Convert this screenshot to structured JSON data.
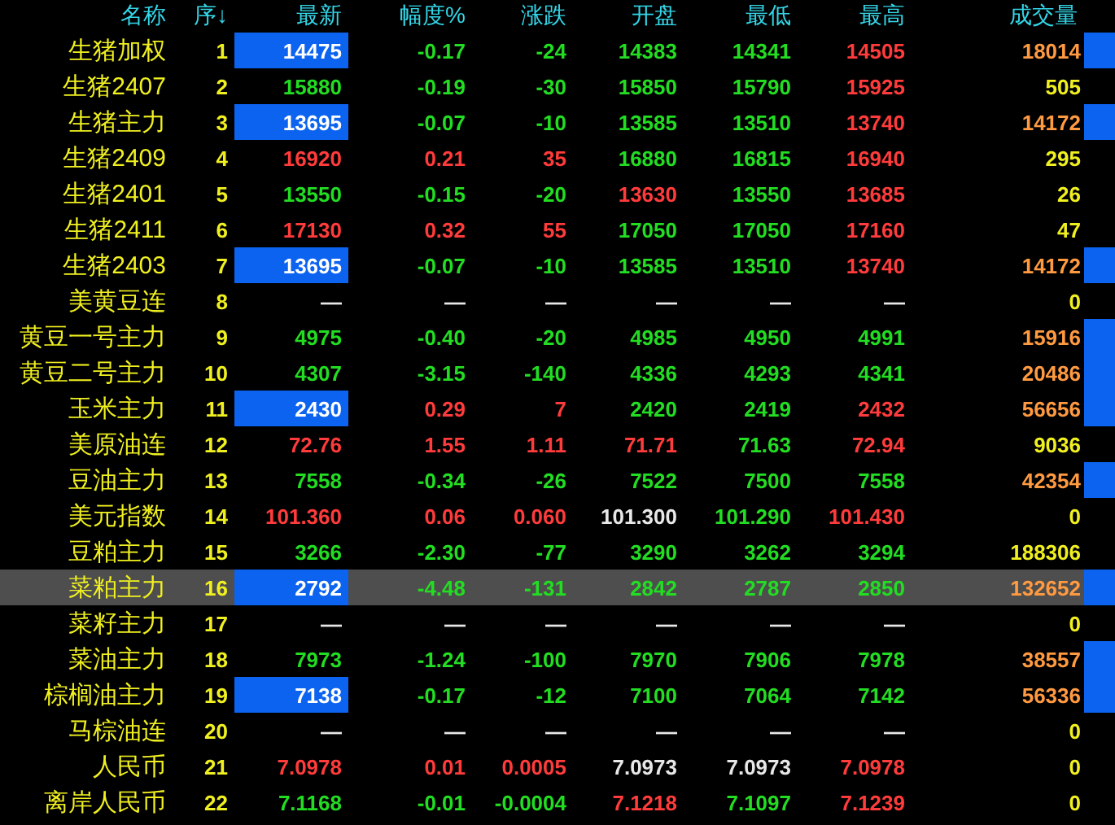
{
  "columns": [
    "名称",
    "序↓",
    "最新",
    "幅度%",
    "涨跌",
    "开盘",
    "最低",
    "最高",
    "成交量"
  ],
  "rows": [
    {
      "name": "生猪加权",
      "index": "1",
      "selected": false,
      "latest": {
        "text": "14475",
        "flash": true
      },
      "cells": [
        {
          "text": "-0.17",
          "color": "#22dd22"
        },
        {
          "text": "-24",
          "color": "#22dd22"
        },
        {
          "text": "14383",
          "color": "#22dd22"
        },
        {
          "text": "14341",
          "color": "#22dd22"
        },
        {
          "text": "14505",
          "color": "#ff3b3b"
        }
      ],
      "volume": "18014",
      "volume_alert": true
    },
    {
      "name": "生猪2407",
      "index": "2",
      "selected": false,
      "latest": {
        "text": "15880",
        "color": "#22dd22",
        "flash": false
      },
      "cells": [
        {
          "text": "-0.19",
          "color": "#22dd22"
        },
        {
          "text": "-30",
          "color": "#22dd22"
        },
        {
          "text": "15850",
          "color": "#22dd22"
        },
        {
          "text": "15790",
          "color": "#22dd22"
        },
        {
          "text": "15925",
          "color": "#ff3b3b"
        }
      ],
      "volume": "505",
      "volume_alert": false
    },
    {
      "name": "生猪主力",
      "index": "3",
      "selected": false,
      "latest": {
        "text": "13695",
        "flash": true
      },
      "cells": [
        {
          "text": "-0.07",
          "color": "#22dd22"
        },
        {
          "text": "-10",
          "color": "#22dd22"
        },
        {
          "text": "13585",
          "color": "#22dd22"
        },
        {
          "text": "13510",
          "color": "#22dd22"
        },
        {
          "text": "13740",
          "color": "#ff3b3b"
        }
      ],
      "volume": "14172",
      "volume_alert": true
    },
    {
      "name": "生猪2409",
      "index": "4",
      "selected": false,
      "latest": {
        "text": "16920",
        "color": "#ff3b3b",
        "flash": false
      },
      "cells": [
        {
          "text": "0.21",
          "color": "#ff3b3b"
        },
        {
          "text": "35",
          "color": "#ff3b3b"
        },
        {
          "text": "16880",
          "color": "#22dd22"
        },
        {
          "text": "16815",
          "color": "#22dd22"
        },
        {
          "text": "16940",
          "color": "#ff3b3b"
        }
      ],
      "volume": "295",
      "volume_alert": false
    },
    {
      "name": "生猪2401",
      "index": "5",
      "selected": false,
      "latest": {
        "text": "13550",
        "color": "#22dd22",
        "flash": false
      },
      "cells": [
        {
          "text": "-0.15",
          "color": "#22dd22"
        },
        {
          "text": "-20",
          "color": "#22dd22"
        },
        {
          "text": "13630",
          "color": "#ff3b3b"
        },
        {
          "text": "13550",
          "color": "#22dd22"
        },
        {
          "text": "13685",
          "color": "#ff3b3b"
        }
      ],
      "volume": "26",
      "volume_alert": false
    },
    {
      "name": "生猪2411",
      "index": "6",
      "selected": false,
      "latest": {
        "text": "17130",
        "color": "#ff3b3b",
        "flash": false
      },
      "cells": [
        {
          "text": "0.32",
          "color": "#ff3b3b"
        },
        {
          "text": "55",
          "color": "#ff3b3b"
        },
        {
          "text": "17050",
          "color": "#22dd22"
        },
        {
          "text": "17050",
          "color": "#22dd22"
        },
        {
          "text": "17160",
          "color": "#ff3b3b"
        }
      ],
      "volume": "47",
      "volume_alert": false
    },
    {
      "name": "生猪2403",
      "index": "7",
      "selected": false,
      "latest": {
        "text": "13695",
        "flash": true
      },
      "cells": [
        {
          "text": "-0.07",
          "color": "#22dd22"
        },
        {
          "text": "-10",
          "color": "#22dd22"
        },
        {
          "text": "13585",
          "color": "#22dd22"
        },
        {
          "text": "13510",
          "color": "#22dd22"
        },
        {
          "text": "13740",
          "color": "#ff3b3b"
        }
      ],
      "volume": "14172",
      "volume_alert": true
    },
    {
      "name": "美黄豆连",
      "index": "8",
      "selected": false,
      "latest": {
        "text": "—",
        "color": "#e8e8e8",
        "flash": false
      },
      "cells": [
        {
          "text": "—",
          "color": "#e8e8e8"
        },
        {
          "text": "—",
          "color": "#e8e8e8"
        },
        {
          "text": "—",
          "color": "#e8e8e8"
        },
        {
          "text": "—",
          "color": "#e8e8e8"
        },
        {
          "text": "—",
          "color": "#e8e8e8"
        }
      ],
      "volume": "0",
      "volume_alert": false
    },
    {
      "name": "黄豆一号主力",
      "index": "9",
      "selected": false,
      "latest": {
        "text": "4975",
        "color": "#22dd22",
        "flash": false
      },
      "cells": [
        {
          "text": "-0.40",
          "color": "#22dd22"
        },
        {
          "text": "-20",
          "color": "#22dd22"
        },
        {
          "text": "4985",
          "color": "#22dd22"
        },
        {
          "text": "4950",
          "color": "#22dd22"
        },
        {
          "text": "4991",
          "color": "#22dd22"
        }
      ],
      "volume": "15916",
      "volume_alert": true
    },
    {
      "name": "黄豆二号主力",
      "index": "10",
      "selected": false,
      "latest": {
        "text": "4307",
        "color": "#22dd22",
        "flash": false
      },
      "cells": [
        {
          "text": "-3.15",
          "color": "#22dd22"
        },
        {
          "text": "-140",
          "color": "#22dd22"
        },
        {
          "text": "4336",
          "color": "#22dd22"
        },
        {
          "text": "4293",
          "color": "#22dd22"
        },
        {
          "text": "4341",
          "color": "#22dd22"
        }
      ],
      "volume": "20486",
      "volume_alert": true
    },
    {
      "name": "玉米主力",
      "index": "11",
      "selected": false,
      "latest": {
        "text": "2430",
        "flash": true
      },
      "cells": [
        {
          "text": "0.29",
          "color": "#ff3b3b"
        },
        {
          "text": "7",
          "color": "#ff3b3b"
        },
        {
          "text": "2420",
          "color": "#22dd22"
        },
        {
          "text": "2419",
          "color": "#22dd22"
        },
        {
          "text": "2432",
          "color": "#ff3b3b"
        }
      ],
      "volume": "56656",
      "volume_alert": true
    },
    {
      "name": "美原油连",
      "index": "12",
      "selected": false,
      "latest": {
        "text": "72.76",
        "color": "#ff3b3b",
        "flash": false
      },
      "cells": [
        {
          "text": "1.55",
          "color": "#ff3b3b"
        },
        {
          "text": "1.11",
          "color": "#ff3b3b"
        },
        {
          "text": "71.71",
          "color": "#ff3b3b"
        },
        {
          "text": "71.63",
          "color": "#22dd22"
        },
        {
          "text": "72.94",
          "color": "#ff3b3b"
        }
      ],
      "volume": "9036",
      "volume_alert": false
    },
    {
      "name": "豆油主力",
      "index": "13",
      "selected": false,
      "latest": {
        "text": "7558",
        "color": "#22dd22",
        "flash": false
      },
      "cells": [
        {
          "text": "-0.34",
          "color": "#22dd22"
        },
        {
          "text": "-26",
          "color": "#22dd22"
        },
        {
          "text": "7522",
          "color": "#22dd22"
        },
        {
          "text": "7500",
          "color": "#22dd22"
        },
        {
          "text": "7558",
          "color": "#22dd22"
        }
      ],
      "volume": "42354",
      "volume_alert": true
    },
    {
      "name": "美元指数",
      "index": "14",
      "selected": false,
      "latest": {
        "text": "101.360",
        "color": "#ff3b3b",
        "flash": false
      },
      "cells": [
        {
          "text": "0.06",
          "color": "#ff3b3b"
        },
        {
          "text": "0.060",
          "color": "#ff3b3b"
        },
        {
          "text": "101.300",
          "color": "#e8e8e8"
        },
        {
          "text": "101.290",
          "color": "#22dd22"
        },
        {
          "text": "101.430",
          "color": "#ff3b3b"
        }
      ],
      "volume": "0",
      "volume_alert": false
    },
    {
      "name": "豆粕主力",
      "index": "15",
      "selected": false,
      "latest": {
        "text": "3266",
        "color": "#22dd22",
        "flash": false
      },
      "cells": [
        {
          "text": "-2.30",
          "color": "#22dd22"
        },
        {
          "text": "-77",
          "color": "#22dd22"
        },
        {
          "text": "3290",
          "color": "#22dd22"
        },
        {
          "text": "3262",
          "color": "#22dd22"
        },
        {
          "text": "3294",
          "color": "#22dd22"
        }
      ],
      "volume": "188306",
      "volume_alert": false
    },
    {
      "name": "菜粕主力",
      "index": "16",
      "selected": true,
      "latest": {
        "text": "2792",
        "flash": true
      },
      "cells": [
        {
          "text": "-4.48",
          "color": "#22dd22"
        },
        {
          "text": "-131",
          "color": "#22dd22"
        },
        {
          "text": "2842",
          "color": "#22dd22"
        },
        {
          "text": "2787",
          "color": "#22dd22"
        },
        {
          "text": "2850",
          "color": "#22dd22"
        }
      ],
      "volume": "132652",
      "volume_alert": true
    },
    {
      "name": "菜籽主力",
      "index": "17",
      "selected": false,
      "latest": {
        "text": "—",
        "color": "#e8e8e8",
        "flash": false
      },
      "cells": [
        {
          "text": "—",
          "color": "#e8e8e8"
        },
        {
          "text": "—",
          "color": "#e8e8e8"
        },
        {
          "text": "—",
          "color": "#e8e8e8"
        },
        {
          "text": "—",
          "color": "#e8e8e8"
        },
        {
          "text": "—",
          "color": "#e8e8e8"
        }
      ],
      "volume": "0",
      "volume_alert": false
    },
    {
      "name": "菜油主力",
      "index": "18",
      "selected": false,
      "latest": {
        "text": "7973",
        "color": "#22dd22",
        "flash": false
      },
      "cells": [
        {
          "text": "-1.24",
          "color": "#22dd22"
        },
        {
          "text": "-100",
          "color": "#22dd22"
        },
        {
          "text": "7970",
          "color": "#22dd22"
        },
        {
          "text": "7906",
          "color": "#22dd22"
        },
        {
          "text": "7978",
          "color": "#22dd22"
        }
      ],
      "volume": "38557",
      "volume_alert": true
    },
    {
      "name": "棕榈油主力",
      "index": "19",
      "selected": false,
      "latest": {
        "text": "7138",
        "flash": true
      },
      "cells": [
        {
          "text": "-0.17",
          "color": "#22dd22"
        },
        {
          "text": "-12",
          "color": "#22dd22"
        },
        {
          "text": "7100",
          "color": "#22dd22"
        },
        {
          "text": "7064",
          "color": "#22dd22"
        },
        {
          "text": "7142",
          "color": "#22dd22"
        }
      ],
      "volume": "56336",
      "volume_alert": true
    },
    {
      "name": "马棕油连",
      "index": "20",
      "selected": false,
      "latest": {
        "text": "—",
        "color": "#e8e8e8",
        "flash": false
      },
      "cells": [
        {
          "text": "—",
          "color": "#e8e8e8"
        },
        {
          "text": "—",
          "color": "#e8e8e8"
        },
        {
          "text": "—",
          "color": "#e8e8e8"
        },
        {
          "text": "—",
          "color": "#e8e8e8"
        },
        {
          "text": "—",
          "color": "#e8e8e8"
        }
      ],
      "volume": "0",
      "volume_alert": false
    },
    {
      "name": "人民币",
      "index": "21",
      "selected": false,
      "latest": {
        "text": "7.0978",
        "color": "#ff3b3b",
        "flash": false
      },
      "cells": [
        {
          "text": "0.01",
          "color": "#ff3b3b"
        },
        {
          "text": "0.0005",
          "color": "#ff3b3b"
        },
        {
          "text": "7.0973",
          "color": "#e8e8e8"
        },
        {
          "text": "7.0973",
          "color": "#e8e8e8"
        },
        {
          "text": "7.0978",
          "color": "#ff3b3b"
        }
      ],
      "volume": "0",
      "volume_alert": false
    },
    {
      "name": "离岸人民币",
      "index": "22",
      "selected": false,
      "latest": {
        "text": "7.1168",
        "color": "#22dd22",
        "flash": false
      },
      "cells": [
        {
          "text": "-0.01",
          "color": "#22dd22"
        },
        {
          "text": "-0.0004",
          "color": "#22dd22"
        },
        {
          "text": "7.1218",
          "color": "#ff3b3b"
        },
        {
          "text": "7.1097",
          "color": "#22dd22"
        },
        {
          "text": "7.1239",
          "color": "#ff3b3b"
        }
      ],
      "volume": "0",
      "volume_alert": false
    }
  ]
}
